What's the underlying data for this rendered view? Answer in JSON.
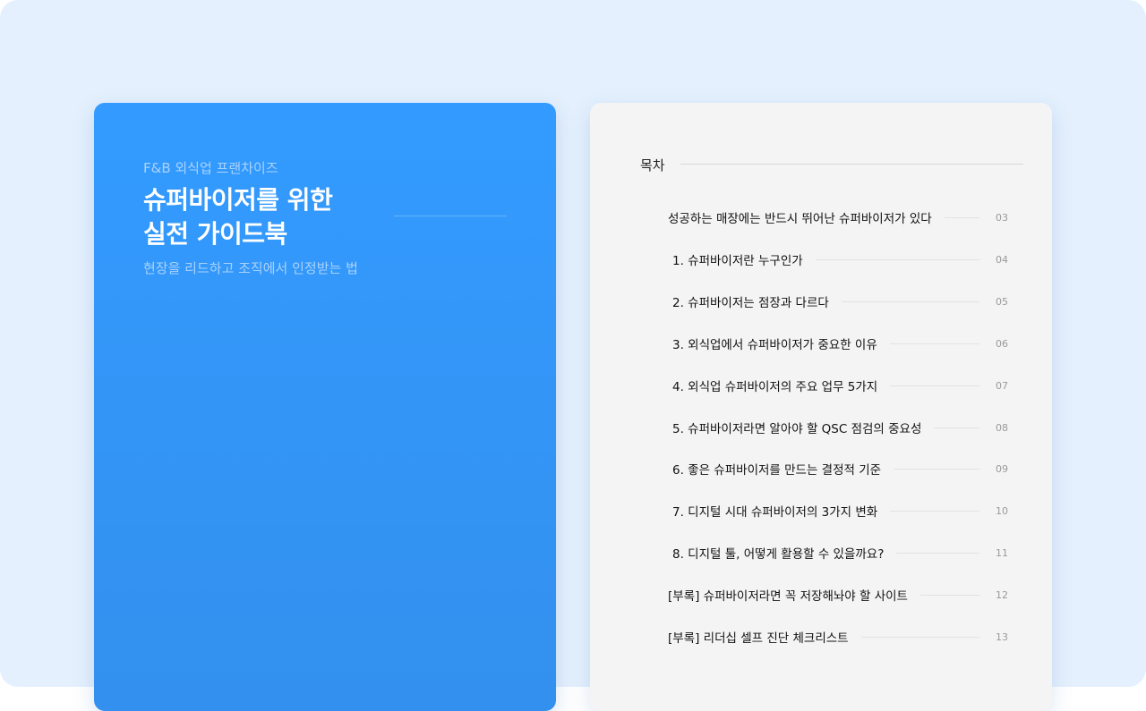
{
  "cover": {
    "eyebrow": "F&B 외식업 프랜차이즈",
    "title_line1": "슈퍼바이저를 위한",
    "title_line2": "실전 가이드북",
    "subtitle": "현장을 리드하고 조직에서 인정받는 법"
  },
  "toc": {
    "title": "목차",
    "items": [
      {
        "label": "성공하는 매장에는 반드시 뛰어난 슈퍼바이저가 있다",
        "page": "03"
      },
      {
        "label": "1. 슈퍼바이저란 누구인가",
        "page": "04"
      },
      {
        "label": "2. 슈퍼바이저는 점장과 다르다",
        "page": "05"
      },
      {
        "label": "3. 외식업에서 슈퍼바이저가 중요한 이유",
        "page": "06"
      },
      {
        "label": "4. 외식업 슈퍼바이저의 주요 업무 5가지",
        "page": "07"
      },
      {
        "label": "5. 슈퍼바이저라면 알아야 할 QSC 점검의 중요성",
        "page": "08"
      },
      {
        "label": "6. 좋은 슈퍼바이저를 만드는 결정적 기준",
        "page": "09"
      },
      {
        "label": "7. 디지털 시대 슈퍼바이저의 3가지 변화",
        "page": "10"
      },
      {
        "label": "8. 디지털 툴, 어떻게 활용할 수 있을까요?",
        "page": "11"
      },
      {
        "label": "[부록] 슈퍼바이저라면 꼭 저장해놔야 할 사이트",
        "page": "12"
      },
      {
        "label": "[부록] 리더십 셀프 진단 체크리스트",
        "page": "13"
      }
    ]
  }
}
